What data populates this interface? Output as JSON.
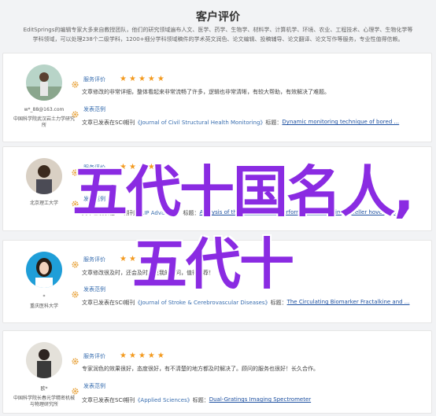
{
  "header": {
    "title": "客户评价",
    "line1": "EditSprings的编辑专家大多来自教授团队，他们的研究领域遍布人文、医学、药学、生物学、材料学、计算机学、环境、农业、工程技术、心理学、生物化学等",
    "line2": "学科领域，可以处理238个二级学科，1200+细分学科领域稿件的学术英文润色、论文编辑、投稿辅导、论文翻译、论文写作等服务，专业性值得信赖。"
  },
  "labels": {
    "service_review": "服务评价",
    "published_example": "发表范例"
  },
  "colors": {
    "star": "#f39a1f",
    "link": "#3a6fb0",
    "watermark": "#8a2be2"
  },
  "reviews": [
    {
      "email": "w*_88@163.com",
      "university": "中国科学院武汉岩土力学研究所",
      "rating": 5,
      "comment": "文章修改的非常详细，整体看起来非常流畅了许多，逻辑也非常清晰，有较大帮助，有效解决了难题。",
      "pub_prefix": "文章已发表在SCI期刊",
      "journal": "《Journal of Civil Structural Health Monitoring》",
      "pub_mid": "标题：",
      "paper_title": "Dynamic monitoring technique of bored ..."
    },
    {
      "email": "",
      "university": "北京理工大学",
      "rating": 5,
      "comment": "",
      "pub_prefix": "文章已发表在SCI期刊",
      "journal": "《AIP Advances》",
      "pub_mid": "标题：",
      "paper_title": "Analysis of the aerodynamic performance of a twin-propeller hovering..."
    },
    {
      "email": "*",
      "university": "重庆医科大学",
      "rating": 5,
      "comment": "文章修改很及时，还会及时回复我的疑问，值得推荐！",
      "pub_prefix": "文章已发表在SCI期刊",
      "journal": "《Journal of Stroke & Cerebrovascular Diseases》",
      "pub_mid": "标题：",
      "paper_title": "The Circulating Biomarker Fractalkine and ..."
    },
    {
      "email": "欧*",
      "university": "中国科学院长春光学精密机械与物理研究所",
      "rating": 5,
      "comment": "专家润色的效果很好，态度很好，有不清楚的地方都及时解决了。顾问的服务也很好！长久合作。",
      "pub_prefix": "文章已发表在SCI期刊",
      "journal": "《Applied Sciences》",
      "pub_mid": "标题：",
      "paper_title": "Dual-Gratings Imaging Spectrometer"
    }
  ],
  "watermark": {
    "line1": "五代十国名人,",
    "line2": "五代十"
  }
}
